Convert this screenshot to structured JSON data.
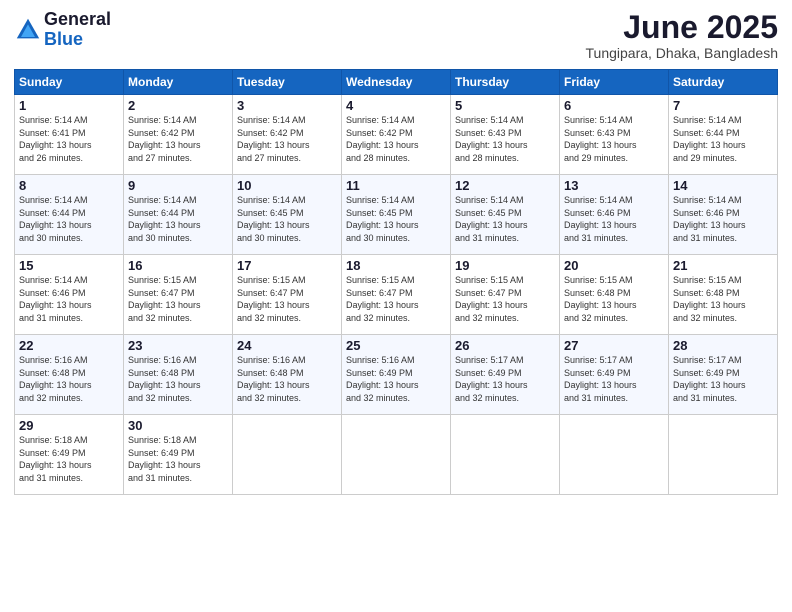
{
  "logo": {
    "general": "General",
    "blue": "Blue"
  },
  "header": {
    "month_year": "June 2025",
    "location": "Tungipara, Dhaka, Bangladesh"
  },
  "weekdays": [
    "Sunday",
    "Monday",
    "Tuesday",
    "Wednesday",
    "Thursday",
    "Friday",
    "Saturday"
  ],
  "weeks": [
    [
      {
        "day": "1",
        "sunrise": "5:14 AM",
        "sunset": "6:41 PM",
        "daylight": "13 hours and 26 minutes."
      },
      {
        "day": "2",
        "sunrise": "5:14 AM",
        "sunset": "6:42 PM",
        "daylight": "13 hours and 27 minutes."
      },
      {
        "day": "3",
        "sunrise": "5:14 AM",
        "sunset": "6:42 PM",
        "daylight": "13 hours and 27 minutes."
      },
      {
        "day": "4",
        "sunrise": "5:14 AM",
        "sunset": "6:42 PM",
        "daylight": "13 hours and 28 minutes."
      },
      {
        "day": "5",
        "sunrise": "5:14 AM",
        "sunset": "6:43 PM",
        "daylight": "13 hours and 28 minutes."
      },
      {
        "day": "6",
        "sunrise": "5:14 AM",
        "sunset": "6:43 PM",
        "daylight": "13 hours and 29 minutes."
      },
      {
        "day": "7",
        "sunrise": "5:14 AM",
        "sunset": "6:44 PM",
        "daylight": "13 hours and 29 minutes."
      }
    ],
    [
      {
        "day": "8",
        "sunrise": "5:14 AM",
        "sunset": "6:44 PM",
        "daylight": "13 hours and 30 minutes."
      },
      {
        "day": "9",
        "sunrise": "5:14 AM",
        "sunset": "6:44 PM",
        "daylight": "13 hours and 30 minutes."
      },
      {
        "day": "10",
        "sunrise": "5:14 AM",
        "sunset": "6:45 PM",
        "daylight": "13 hours and 30 minutes."
      },
      {
        "day": "11",
        "sunrise": "5:14 AM",
        "sunset": "6:45 PM",
        "daylight": "13 hours and 30 minutes."
      },
      {
        "day": "12",
        "sunrise": "5:14 AM",
        "sunset": "6:45 PM",
        "daylight": "13 hours and 31 minutes."
      },
      {
        "day": "13",
        "sunrise": "5:14 AM",
        "sunset": "6:46 PM",
        "daylight": "13 hours and 31 minutes."
      },
      {
        "day": "14",
        "sunrise": "5:14 AM",
        "sunset": "6:46 PM",
        "daylight": "13 hours and 31 minutes."
      }
    ],
    [
      {
        "day": "15",
        "sunrise": "5:14 AM",
        "sunset": "6:46 PM",
        "daylight": "13 hours and 31 minutes."
      },
      {
        "day": "16",
        "sunrise": "5:15 AM",
        "sunset": "6:47 PM",
        "daylight": "13 hours and 32 minutes."
      },
      {
        "day": "17",
        "sunrise": "5:15 AM",
        "sunset": "6:47 PM",
        "daylight": "13 hours and 32 minutes."
      },
      {
        "day": "18",
        "sunrise": "5:15 AM",
        "sunset": "6:47 PM",
        "daylight": "13 hours and 32 minutes."
      },
      {
        "day": "19",
        "sunrise": "5:15 AM",
        "sunset": "6:47 PM",
        "daylight": "13 hours and 32 minutes."
      },
      {
        "day": "20",
        "sunrise": "5:15 AM",
        "sunset": "6:48 PM",
        "daylight": "13 hours and 32 minutes."
      },
      {
        "day": "21",
        "sunrise": "5:15 AM",
        "sunset": "6:48 PM",
        "daylight": "13 hours and 32 minutes."
      }
    ],
    [
      {
        "day": "22",
        "sunrise": "5:16 AM",
        "sunset": "6:48 PM",
        "daylight": "13 hours and 32 minutes."
      },
      {
        "day": "23",
        "sunrise": "5:16 AM",
        "sunset": "6:48 PM",
        "daylight": "13 hours and 32 minutes."
      },
      {
        "day": "24",
        "sunrise": "5:16 AM",
        "sunset": "6:48 PM",
        "daylight": "13 hours and 32 minutes."
      },
      {
        "day": "25",
        "sunrise": "5:16 AM",
        "sunset": "6:49 PM",
        "daylight": "13 hours and 32 minutes."
      },
      {
        "day": "26",
        "sunrise": "5:17 AM",
        "sunset": "6:49 PM",
        "daylight": "13 hours and 32 minutes."
      },
      {
        "day": "27",
        "sunrise": "5:17 AM",
        "sunset": "6:49 PM",
        "daylight": "13 hours and 31 minutes."
      },
      {
        "day": "28",
        "sunrise": "5:17 AM",
        "sunset": "6:49 PM",
        "daylight": "13 hours and 31 minutes."
      }
    ],
    [
      {
        "day": "29",
        "sunrise": "5:18 AM",
        "sunset": "6:49 PM",
        "daylight": "13 hours and 31 minutes."
      },
      {
        "day": "30",
        "sunrise": "5:18 AM",
        "sunset": "6:49 PM",
        "daylight": "13 hours and 31 minutes."
      },
      null,
      null,
      null,
      null,
      null
    ]
  ],
  "labels": {
    "sunrise": "Sunrise:",
    "sunset": "Sunset:",
    "daylight": "Daylight:"
  }
}
